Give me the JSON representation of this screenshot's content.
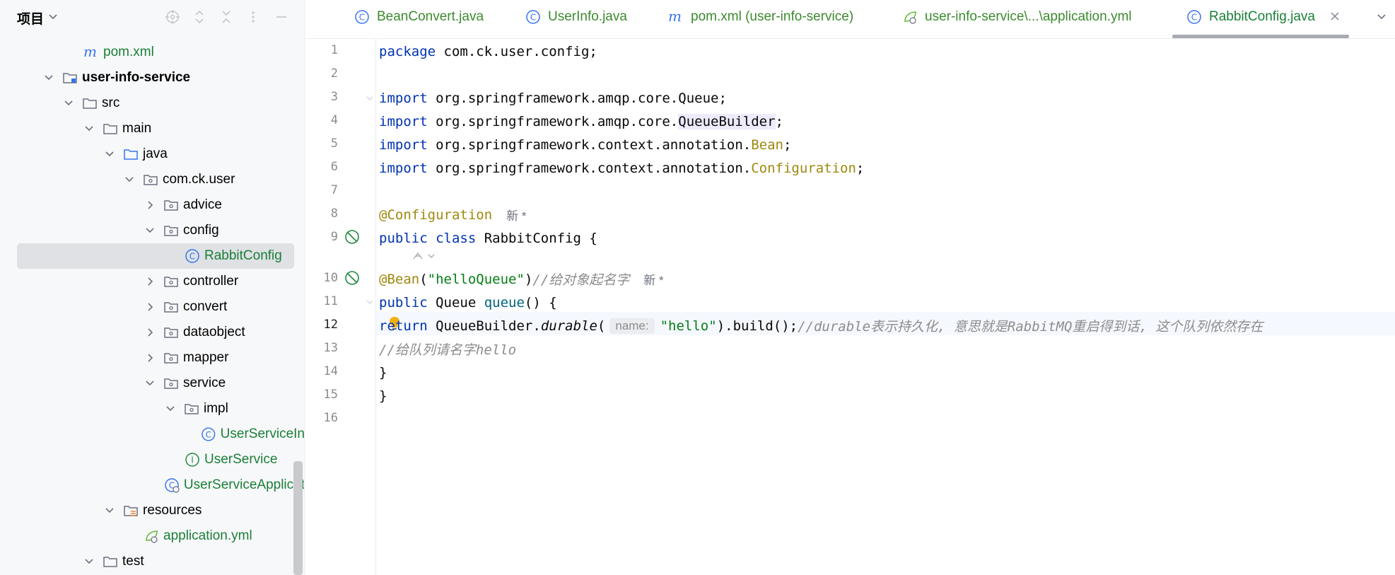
{
  "project_panel": {
    "title": "项目",
    "tree": [
      {
        "label": "pom.xml",
        "icon": "maven-icon",
        "color": "green"
      },
      {
        "label": "user-info-service",
        "icon": "module-folder-icon",
        "bold": true
      },
      {
        "label": "src",
        "icon": "folder-icon"
      },
      {
        "label": "main",
        "icon": "folder-icon"
      },
      {
        "label": "java",
        "icon": "source-folder-icon"
      },
      {
        "label": "com.ck.user",
        "icon": "package-icon"
      },
      {
        "label": "advice",
        "icon": "package-icon"
      },
      {
        "label": "config",
        "icon": "package-icon"
      },
      {
        "label": "RabbitConfig",
        "icon": "class-icon",
        "color": "green",
        "selected": true
      },
      {
        "label": "controller",
        "icon": "package-icon"
      },
      {
        "label": "convert",
        "icon": "package-icon"
      },
      {
        "label": "dataobject",
        "icon": "package-icon"
      },
      {
        "label": "mapper",
        "icon": "package-icon"
      },
      {
        "label": "service",
        "icon": "package-icon"
      },
      {
        "label": "impl",
        "icon": "package-icon"
      },
      {
        "label": "UserServiceIn",
        "icon": "class-icon",
        "color": "green"
      },
      {
        "label": "UserService",
        "icon": "interface-icon",
        "color": "green"
      },
      {
        "label": "UserServiceApplicat",
        "icon": "spring-boot-class-icon",
        "color": "green"
      },
      {
        "label": "resources",
        "icon": "resources-folder-icon"
      },
      {
        "label": "application.yml",
        "icon": "spring-yml-icon",
        "color": "green"
      },
      {
        "label": "test",
        "icon": "folder-icon"
      }
    ]
  },
  "tabs": [
    {
      "label": "BeanConvert.java",
      "icon": "class-icon"
    },
    {
      "label": "UserInfo.java",
      "icon": "class-icon"
    },
    {
      "label": "pom.xml (user-info-service)",
      "icon": "maven-icon"
    },
    {
      "label": "user-info-service\\...\\application.yml",
      "icon": "spring-yml-icon"
    },
    {
      "label": "RabbitConfig.java",
      "icon": "class-icon",
      "active": true
    }
  ],
  "editor": {
    "line_numbers": [
      "1",
      "2",
      "3",
      "4",
      "5",
      "6",
      "7",
      "8",
      "9",
      "10",
      "11",
      "12",
      "13",
      "14",
      "15",
      "16"
    ],
    "current_line": "12",
    "code": {
      "l1_kw": "package",
      "l1_rest": " com.ck.user.config;",
      "l3_kw": "import",
      "l3_rest": " org.springframework.amqp.core.Queue;",
      "l4_kw": "import",
      "l4_pre": " org.springframework.amqp.core.",
      "l4_hl": "QueueBuilder",
      "l4_end": ";",
      "l5_kw": "import",
      "l5_pre": " org.springframework.context.annotation.",
      "l5_ann": "Bean",
      "l5_end": ";",
      "l6_kw": "import",
      "l6_pre": " org.springframework.context.annotation.",
      "l6_ann": "Configuration",
      "l6_end": ";",
      "l8_ann": "@Configuration",
      "l8_hint": "新 *",
      "l9_kw": "public class",
      "l9_rest": " RabbitConfig {",
      "l10_ann": "@Bean",
      "l10_p1": "(",
      "l10_str": "\"helloQueue\"",
      "l10_p2": ")",
      "l10_cm": "//给对象起名字",
      "l10_hint": "新 *",
      "l11_kw": "public",
      "l11_type": " Queue ",
      "l11_fn": "queue",
      "l11_rest": "() {",
      "l12_kw": "return",
      "l12_sp": " ",
      "l12_cls": "QueueBuilder",
      "l12_dot": ".",
      "l12_m": "durable",
      "l12_p": "(",
      "l12_inlay": "name:",
      "l12_str": "\"hello\"",
      "l12_rest": ").build();",
      "l12_cm": "//durable表示持久化, 意思就是RabbitMQ重启得到话, 这个队列依然存在",
      "l13_cm": "//给队列请名字hello",
      "l14": "}",
      "l15": "}"
    }
  },
  "colors": {
    "keyword": "#0033b3",
    "annotation": "#9e880d",
    "string": "#067d17",
    "comment": "#8c8c8c",
    "file_green": "#1a7f37"
  }
}
